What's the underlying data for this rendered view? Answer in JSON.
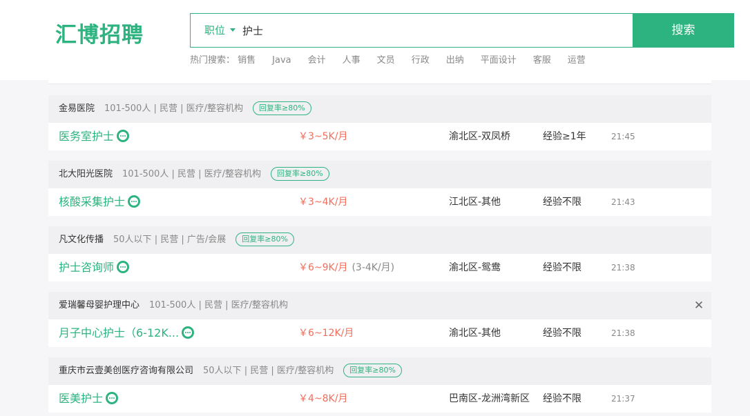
{
  "header": {
    "logo": "汇博招聘",
    "search": {
      "type_label": "职位",
      "query": "护士",
      "button_label": "搜索"
    },
    "hot_search": {
      "label": "热门搜索：",
      "items": [
        "销售",
        "Java",
        "会计",
        "人事",
        "文员",
        "行政",
        "出纳",
        "平面设计",
        "客服",
        "运营"
      ]
    }
  },
  "jobs": [
    {
      "company": "金易医院",
      "company_info": "101-500人 | 民营 | 医疗/整容机构",
      "badge": "回复率≥80%",
      "title": "医务室护士",
      "salary": "￥3~5K/月",
      "salary_extra": "",
      "location": "渝北区-双凤桥",
      "experience": "经验≥1年",
      "time": "21:45"
    },
    {
      "company": "北大阳光医院",
      "company_info": "101-500人 | 民营 | 医疗/整容机构",
      "badge": "回复率≥80%",
      "title": "核酸采集护士",
      "salary": "￥3~4K/月",
      "salary_extra": "",
      "location": "江北区-其他",
      "experience": "经验不限",
      "time": "21:43"
    },
    {
      "company": "凡文化传播",
      "company_info": "50人以下 | 民营 | 广告/会展",
      "badge": "回复率≥80%",
      "title": "护士咨询师",
      "salary": "￥6~9K/月",
      "salary_extra": "(3-4K/月)",
      "location": "渝北区-鸳鸯",
      "experience": "经验不限",
      "time": "21:38"
    },
    {
      "company": "爱瑞馨母婴护理中心",
      "company_info": "101-500人 | 民营 | 医疗/整容机构",
      "badge": "",
      "close": "✕",
      "title": "月子中心护士（6-12K...",
      "salary": "￥6~12K/月",
      "salary_extra": "",
      "location": "渝北区-其他",
      "experience": "经验不限",
      "time": "21:38"
    },
    {
      "company": "重庆市云壹美创医疗咨询有限公司",
      "company_info": "50人以下 | 民营 | 医疗/整容机构",
      "badge": "回复率≥80%",
      "title": "医美护士",
      "salary": "￥4~8K/月",
      "salary_extra": "",
      "location": "巴南区-龙洲湾新区",
      "experience": "经验不限",
      "time": "21:37"
    }
  ],
  "colors": {
    "brand": "#2db37f",
    "salary": "#f26d5b",
    "muted": "#888888"
  },
  "icons": [
    "chat-icon",
    "chevron-down-icon",
    "close-icon"
  ]
}
